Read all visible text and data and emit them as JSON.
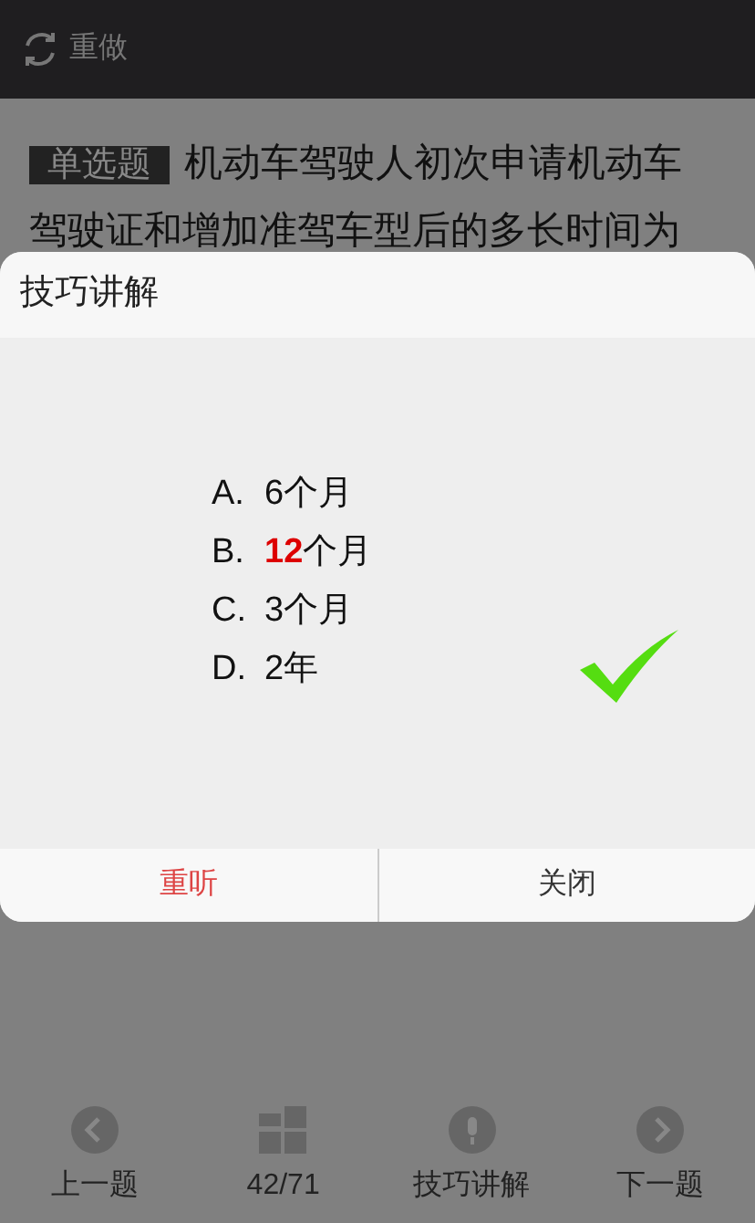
{
  "header": {
    "redo_label": "重做"
  },
  "question": {
    "type_tag": "单选题",
    "text_lines": [
      "机动车驾驶人初次申请机动车",
      "驾驶证和增加准驾车型后的多长时间为"
    ]
  },
  "dialog": {
    "title": "技巧讲解",
    "options": [
      {
        "letter": "A.",
        "text": "6个月"
      },
      {
        "letter": "B.",
        "text": "**12**个月"
      },
      {
        "letter": "C.",
        "text": "3个月"
      },
      {
        "letter": "D.",
        "text": "2年"
      }
    ],
    "correct": true,
    "buttons": [
      {
        "label": "重听",
        "kind": "primary"
      },
      {
        "label": "关闭",
        "kind": "normal"
      }
    ]
  },
  "bottom_nav": [
    {
      "label": "上一题",
      "kind": "prev"
    },
    {
      "label": "42/71",
      "kind": "grid"
    },
    {
      "label": "技巧讲解",
      "kind": "mic"
    },
    {
      "label": "下一题",
      "kind": "next"
    }
  ]
}
